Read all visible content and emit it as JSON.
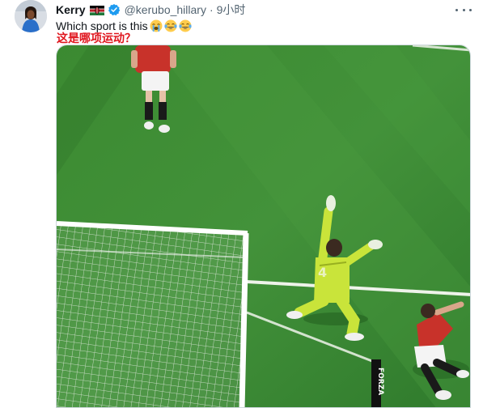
{
  "author": {
    "display_name": "Kerry",
    "handle": "@kerubo_hillary",
    "separator": "·",
    "time": "9小时"
  },
  "tweet": {
    "text": "Which sport is this",
    "emojis": [
      "loudly-crying-face-emoji",
      "face-with-tears-of-joy-emoji",
      "face-with-tears-of-joy-emoji"
    ]
  },
  "overlay_translation": "这是哪项运动？",
  "media": {
    "kind": "photo",
    "jersey_number": "4",
    "board_text": "FORZA"
  },
  "icons": {
    "flag": "kenya-flag-icon",
    "verified": "verified-badge-icon",
    "more": "more-options-icon"
  },
  "colors": {
    "verified_blue": "#1d9bf0",
    "translation_red": "#e0161e",
    "keeper_kit": "#c9e43a",
    "player_kit": "#c8322a",
    "pitch": "#3f8a34"
  }
}
